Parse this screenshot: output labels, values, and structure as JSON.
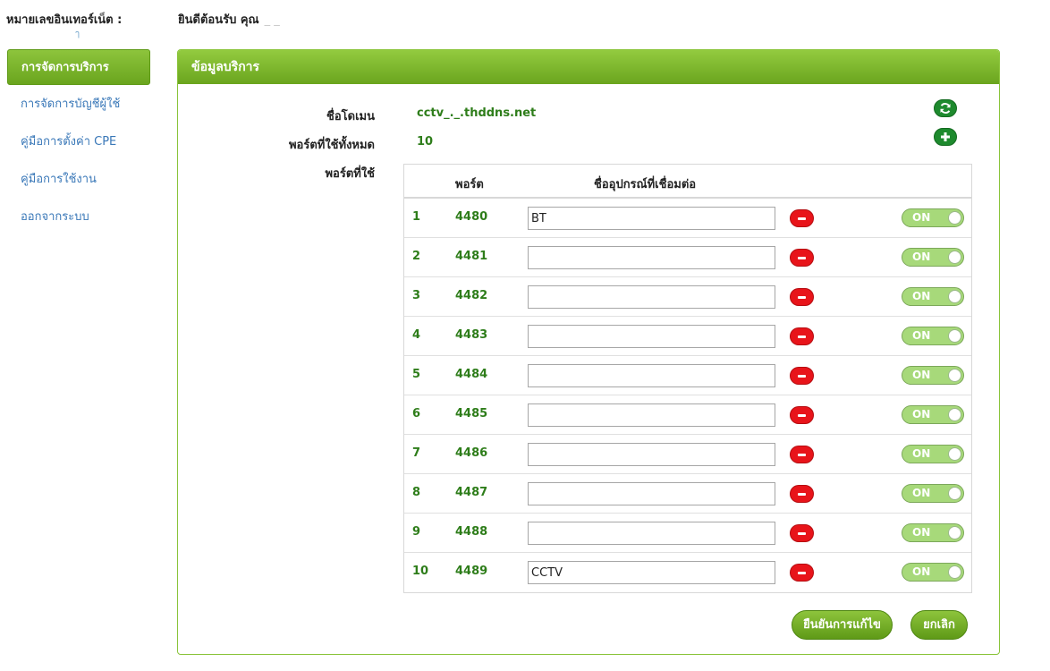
{
  "header": {
    "internet_number_label": "หมายเลขอินเทอร์เน็ต :",
    "internet_number_value": "ๅ",
    "welcome": "ยินดีต้อนรับ คุณ",
    "user_name": "_ _"
  },
  "sidebar": {
    "items": [
      {
        "label": "การจัดการบริการ",
        "active": true
      },
      {
        "label": "การจัดการบัญชีผู้ใช้",
        "active": false
      },
      {
        "label": "คู่มือการตั้งค่า CPE",
        "active": false
      },
      {
        "label": "คู่มือการใช้งาน",
        "active": false
      },
      {
        "label": "ออกจากระบบ",
        "active": false
      }
    ]
  },
  "panel": {
    "title": "ข้อมูลบริการ",
    "domain_label": "ชื่อโดเมน",
    "domain_value": "cctv_._.thddns.net",
    "total_ports_label": "พอร์ตที่ใช้ทั้งหมด",
    "total_ports_value": "10",
    "used_ports_label": "พอร์ตที่ใช้",
    "refresh_icon": "refresh-icon",
    "add_icon": "plus-icon"
  },
  "ports_table": {
    "col_port": "พอร์ต",
    "col_device": "ชื่ออุปกรณ์ที่เชื่อมต่อ",
    "toggle_label": "ON",
    "rows": [
      {
        "num": "1",
        "port": "4480",
        "device": "BT"
      },
      {
        "num": "2",
        "port": "4481",
        "device": ""
      },
      {
        "num": "3",
        "port": "4482",
        "device": ""
      },
      {
        "num": "4",
        "port": "4483",
        "device": ""
      },
      {
        "num": "5",
        "port": "4484",
        "device": ""
      },
      {
        "num": "6",
        "port": "4485",
        "device": ""
      },
      {
        "num": "7",
        "port": "4486",
        "device": ""
      },
      {
        "num": "8",
        "port": "4487",
        "device": ""
      },
      {
        "num": "9",
        "port": "4488",
        "device": ""
      },
      {
        "num": "10",
        "port": "4489",
        "device": "CCTV"
      }
    ]
  },
  "actions": {
    "confirm_label": "ยืนยันการแก้ไข",
    "cancel_label": "ยกเลิก"
  },
  "colors": {
    "accent_green": "#6aa51e",
    "value_green": "#2e7d1a",
    "remove_red": "#e8141a",
    "link_blue": "#3a78b8"
  }
}
